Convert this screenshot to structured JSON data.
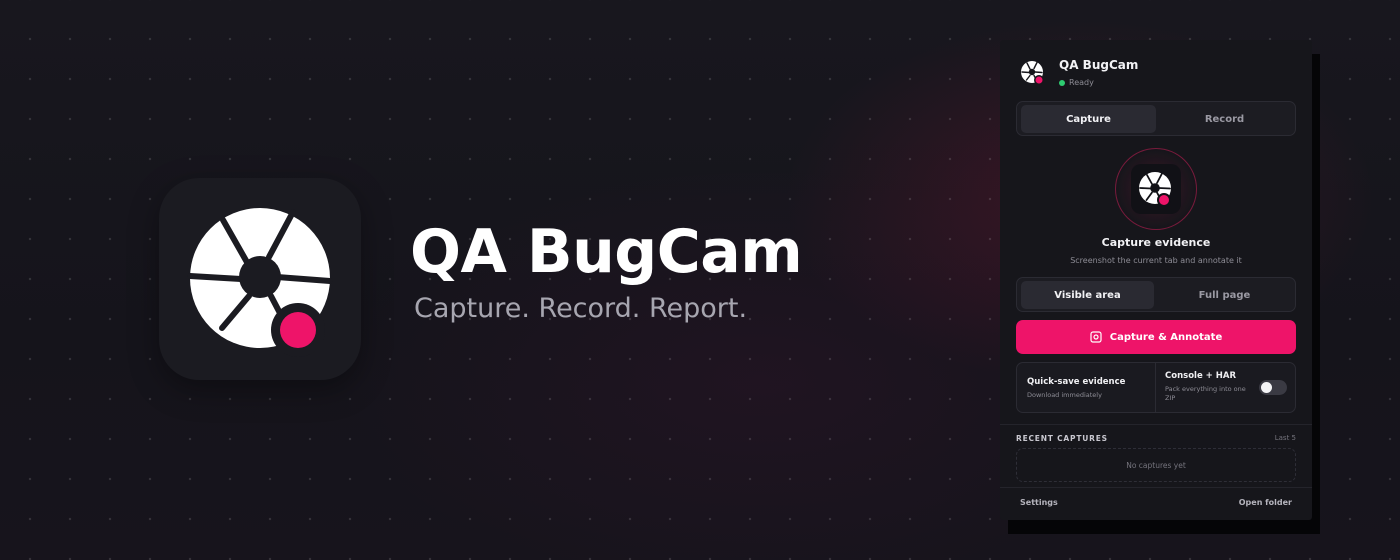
{
  "hero": {
    "title": "QA BugCam",
    "tagline": "Capture. Record. Report."
  },
  "popup": {
    "app_name": "QA BugCam",
    "status": "Ready",
    "status_color": "#2ecc71",
    "mode_tabs": [
      {
        "label": "Capture",
        "active": true
      },
      {
        "label": "Record",
        "active": false
      }
    ],
    "capture_title": "Capture evidence",
    "capture_description": "Screenshot the current tab and annotate it",
    "area_options": [
      {
        "label": "Visible area",
        "active": true
      },
      {
        "label": "Full page",
        "active": false
      }
    ],
    "primary_button": {
      "label": "Capture & Annotate",
      "icon": "capture-icon"
    },
    "quick_save": {
      "title": "Quick-save evidence",
      "description": "Download immediately"
    },
    "console_har": {
      "title": "Console + HAR",
      "description": "Pack everything into one ZIP",
      "enabled": false
    },
    "recent": {
      "title": "RECENT CAPTURES",
      "count_label": "Last 5",
      "empty_text": "No captures yet"
    },
    "footer": {
      "settings": "Settings",
      "open_folder": "Open folder"
    }
  },
  "colors": {
    "accent": "#ee1469",
    "background": "#141419",
    "panel": "#16161b"
  },
  "icons": [
    "camera-shutter-icon",
    "record-dot-icon",
    "capture-icon"
  ]
}
